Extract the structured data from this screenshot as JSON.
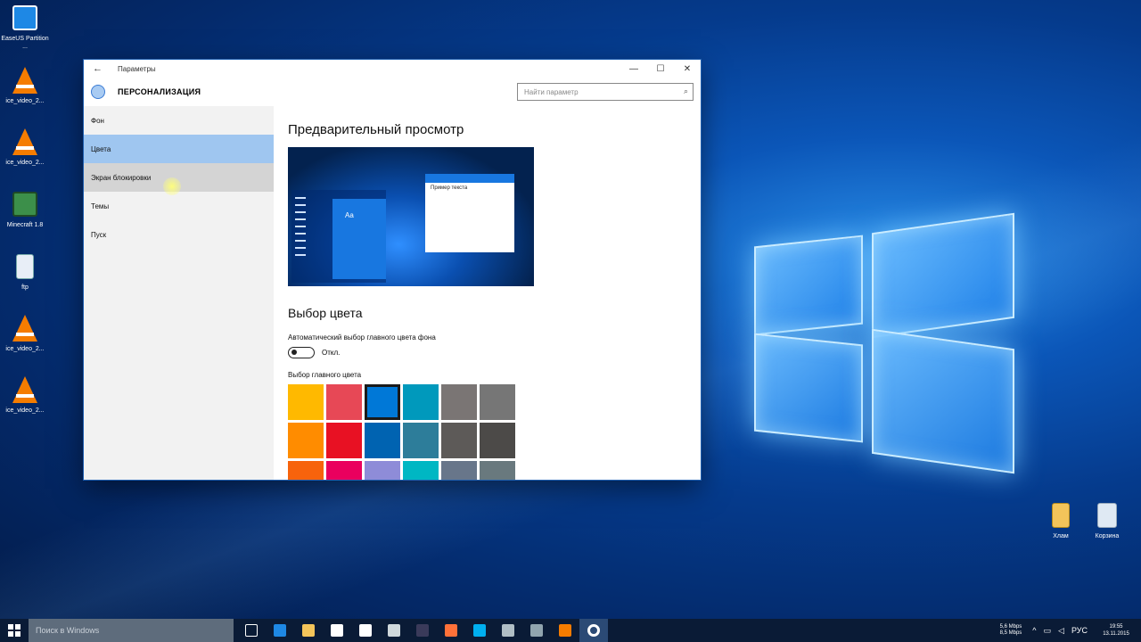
{
  "desktop": {
    "icons": [
      {
        "label": "EaseUS Partition ...",
        "icon": "easeus-icon",
        "color": "#1e88e5"
      },
      {
        "label": "ice_video_2...",
        "icon": "vlc-icon"
      },
      {
        "label": "ice_video_2...",
        "icon": "vlc-icon"
      },
      {
        "label": "Minecraft 1.8",
        "icon": "minecraft-icon"
      },
      {
        "label": "ftp",
        "icon": "file-icon"
      },
      {
        "label": "ice_video_2...",
        "icon": "vlc-icon"
      },
      {
        "label": "ice_video_2...",
        "icon": "vlc-icon"
      }
    ],
    "right_icons": [
      {
        "label": "Хлам",
        "icon": "folder-zip-icon"
      },
      {
        "label": "Корзина",
        "icon": "recycle-bin-icon"
      }
    ]
  },
  "window": {
    "title": "Параметры",
    "back_glyph": "←",
    "minimize_glyph": "—",
    "maximize_glyph": "☐",
    "close_glyph": "✕",
    "section_title": "ПЕРСОНАЛИЗАЦИЯ",
    "search_placeholder": "Найти параметр",
    "search_icon_glyph": "⌕",
    "accent_color": "#0063b1",
    "nav": [
      {
        "label": "Фон",
        "state": "normal"
      },
      {
        "label": "Цвета",
        "state": "selected"
      },
      {
        "label": "Экран блокировки",
        "state": "hover"
      },
      {
        "label": "Темы",
        "state": "normal"
      },
      {
        "label": "Пуск",
        "state": "normal"
      }
    ]
  },
  "content": {
    "preview_title": "Предварительный просмотр",
    "preview_tile_text": "Aa",
    "preview_window_text": "Пример текста",
    "color_title": "Выбор цвета",
    "auto_label": "Автоматический выбор главного цвета фона",
    "toggle_state": "Откл.",
    "main_color_label": "Выбор главного цвета",
    "swatches": [
      "#ffb900",
      "#e74856",
      "#0078d7",
      "#0099bc",
      "#7a7574",
      "#767676",
      "#ff8c00",
      "#e81123",
      "#0063b1",
      "#2d7d9a",
      "#5d5a58",
      "#4c4a48",
      "#f7630c",
      "#ea005e",
      "#8e8cd8",
      "#00b7c3",
      "#68768a",
      "#69797e"
    ],
    "selected_swatch": 2
  },
  "taskbar": {
    "search_placeholder": "Поиск в Windows",
    "apps": [
      "task-view-icon",
      "edge-icon",
      "explorer-icon",
      "store-icon",
      "network-icon",
      "app-icon",
      "premiere-icon",
      "firefox-icon",
      "skype-icon",
      "app2-icon",
      "app3-icon",
      "vlc-icon",
      "settings-icon"
    ],
    "net_up": "5,6 Mbps",
    "net_down": "8,5 Mbps",
    "language": "РУС",
    "time": "19:55",
    "date": "13.11.2015"
  }
}
